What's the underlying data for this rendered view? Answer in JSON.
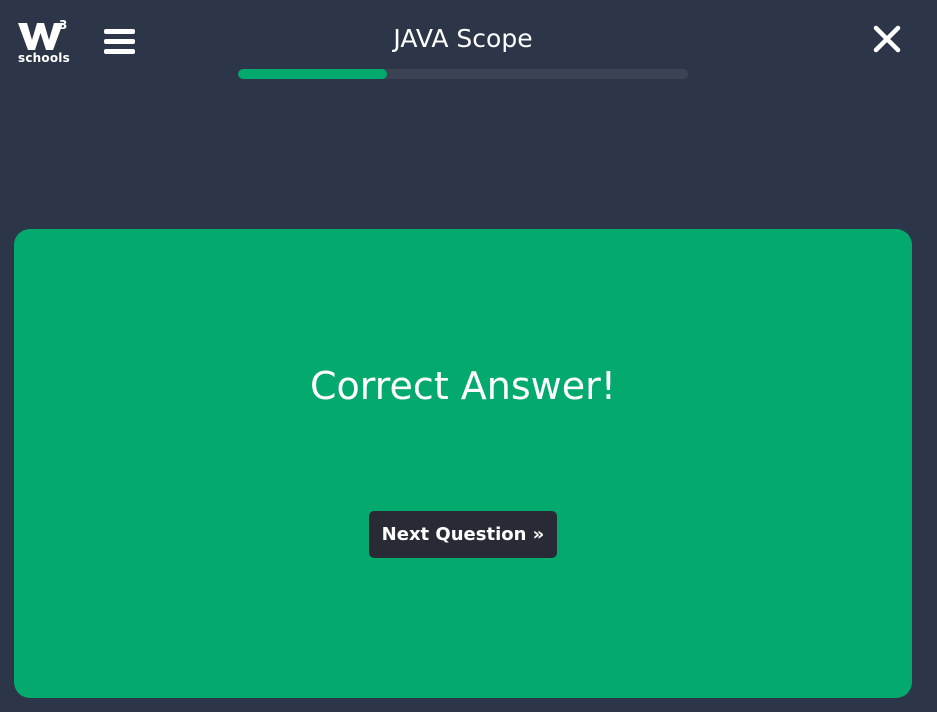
{
  "brand": {
    "superscript": "3",
    "wordmark": "schools",
    "icon": "w3schools-logo"
  },
  "header": {
    "menu_icon": "hamburger-menu-icon",
    "title": "JAVA Scope",
    "close_icon": "close-icon",
    "progress_fraction": 0.33
  },
  "result": {
    "message": "Correct Answer!",
    "next_label": "Next Question »"
  },
  "colors": {
    "background": "#2d3548",
    "correct_green": "#04aa6d",
    "button_dark": "#282a35",
    "progress_track": "#3b4455"
  }
}
